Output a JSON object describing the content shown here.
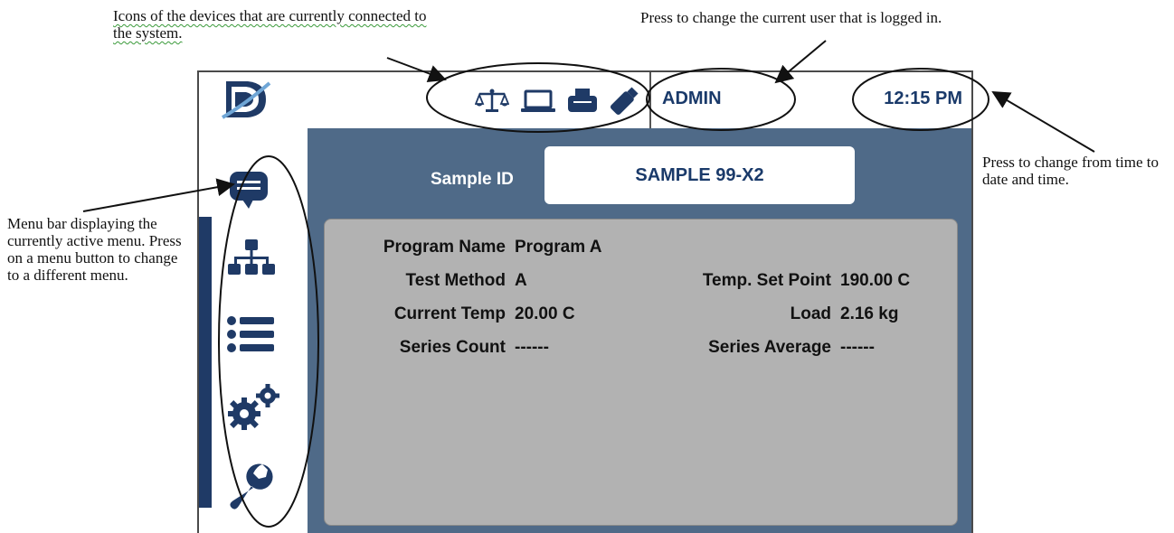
{
  "annotations": {
    "devices_note": "Icons of the devices that are currently connected to the system.",
    "user_note": "Press to change the current user that is logged  in.",
    "time_note": "Press to change from time to date and  time.",
    "menu_note": "Menu bar displaying the currently active menu. Press on a menu button to change to a different menu."
  },
  "header": {
    "user": "ADMIN",
    "time": "12:15 PM",
    "device_icons": [
      "balance-scale-icon",
      "laptop-icon",
      "printer-icon",
      "usb-drive-icon"
    ]
  },
  "sidebar": {
    "items": [
      {
        "icon": "chat-icon"
      },
      {
        "icon": "network-icon"
      },
      {
        "icon": "list-icon"
      },
      {
        "icon": "gears-icon"
      },
      {
        "icon": "wrench-icon"
      }
    ]
  },
  "sample": {
    "label": "Sample ID",
    "value": "SAMPLE 99-X2"
  },
  "info": {
    "program_name_label": "Program Name",
    "program_name_value": "Program A",
    "test_method_label": "Test Method",
    "test_method_value": "A",
    "current_temp_label": "Current Temp",
    "current_temp_value": "20.00 C",
    "series_count_label": "Series Count",
    "series_count_value": "------",
    "temp_set_point_label": "Temp. Set Point",
    "temp_set_point_value": "190.00 C",
    "load_label": "Load",
    "load_value": "2.16 kg",
    "series_average_label": "Series Average",
    "series_average_value": "------"
  },
  "colors": {
    "panel_bg": "#4f6a88",
    "sidebar_accent": "#1f3a66",
    "icon_blue": "#1f3a66",
    "info_panel": "#b2b2b2"
  }
}
